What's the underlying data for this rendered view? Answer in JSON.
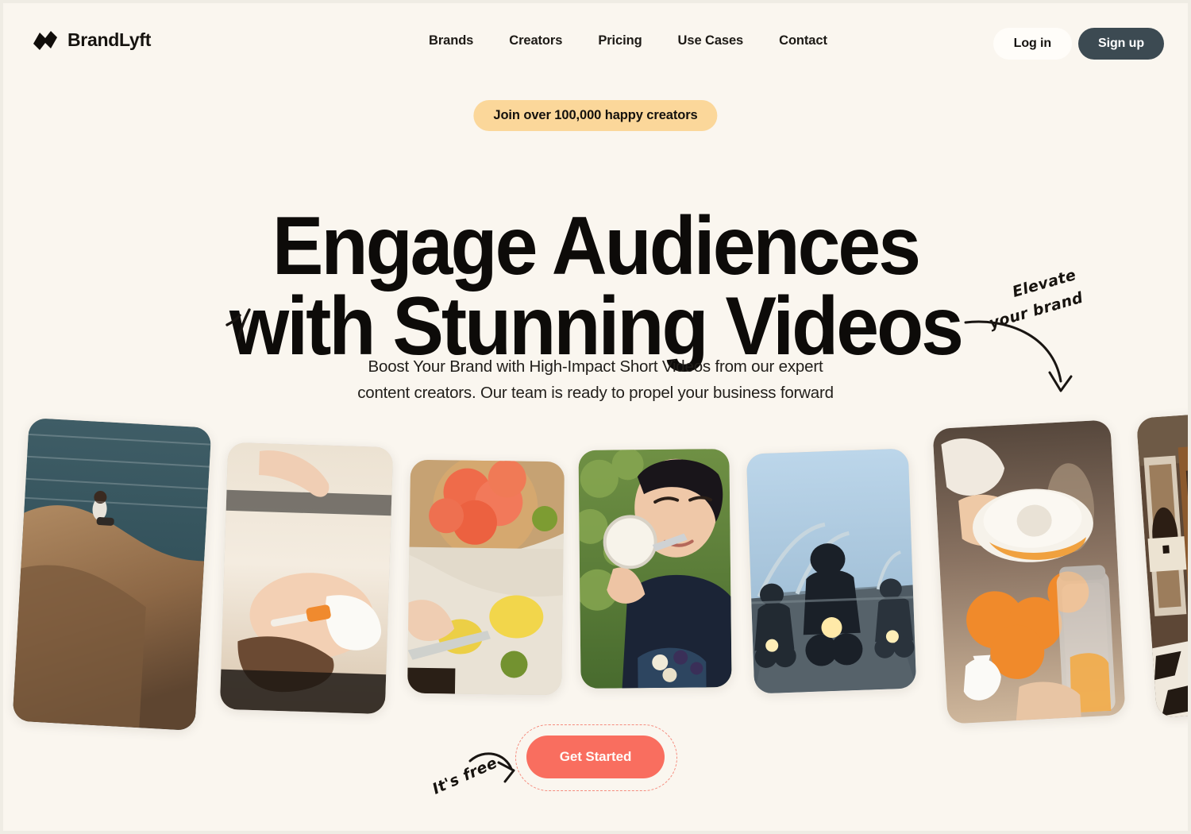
{
  "theme": {
    "page_bg": "#faf6ef",
    "outer_bg": "#efece4",
    "ink": "#0d0b09",
    "badge_bg": "#fbd79a",
    "signup_bg": "#3c4a52",
    "cta_bg": "#f96e5f",
    "cta_ring": "#f58c7e"
  },
  "nav": {
    "brand": "BrandLyft",
    "logo_icon": "brandlyft-logo-icon",
    "links": [
      {
        "label": "Brands"
      },
      {
        "label": "Creators"
      },
      {
        "label": "Pricing"
      },
      {
        "label": "Use Cases"
      },
      {
        "label": "Contact"
      }
    ],
    "login_label": "Log in",
    "signup_label": "Sign up"
  },
  "hero": {
    "badge": "Join over 100,000 happy creators",
    "headline_line1": "Engage Audiences",
    "headline_line2": "with Stunning Videos",
    "subtext": "Boost Your Brand with High-Impact Short Videos from our expert content creators. Our team is ready to propel your business forward",
    "cta_label": "Get Started"
  },
  "annotations": {
    "elevate_line1": "Elevate",
    "elevate_line2": "your brand",
    "elevate_arrow_icon": "curved-arrow-down-icon",
    "its_free": "It's free",
    "its_free_arrow_icon": "curved-arrow-right-icon",
    "tick_doodle_icon": "sparkle-strokes-icon"
  },
  "gallery": {
    "cards": [
      {
        "id": "card-cliff-ocean",
        "alt": "Person sitting on a coastal rock above the ocean"
      },
      {
        "id": "card-facial-mask",
        "alt": "Woman receiving a white facial mask treatment"
      },
      {
        "id": "card-citrus-cutting",
        "alt": "Hands slicing lemons beside a plate of grapefruit"
      },
      {
        "id": "card-eating-yogurt",
        "alt": "Woman eating a fruit and yogurt bowl outdoors"
      },
      {
        "id": "card-motorcycles",
        "alt": "Motorcyclists riding on a highway bridge"
      },
      {
        "id": "card-juicing-oranges",
        "alt": "Hands juicing oranges into a glass jar"
      },
      {
        "id": "card-interior",
        "alt": "Warm interior with patterned floor"
      }
    ]
  }
}
